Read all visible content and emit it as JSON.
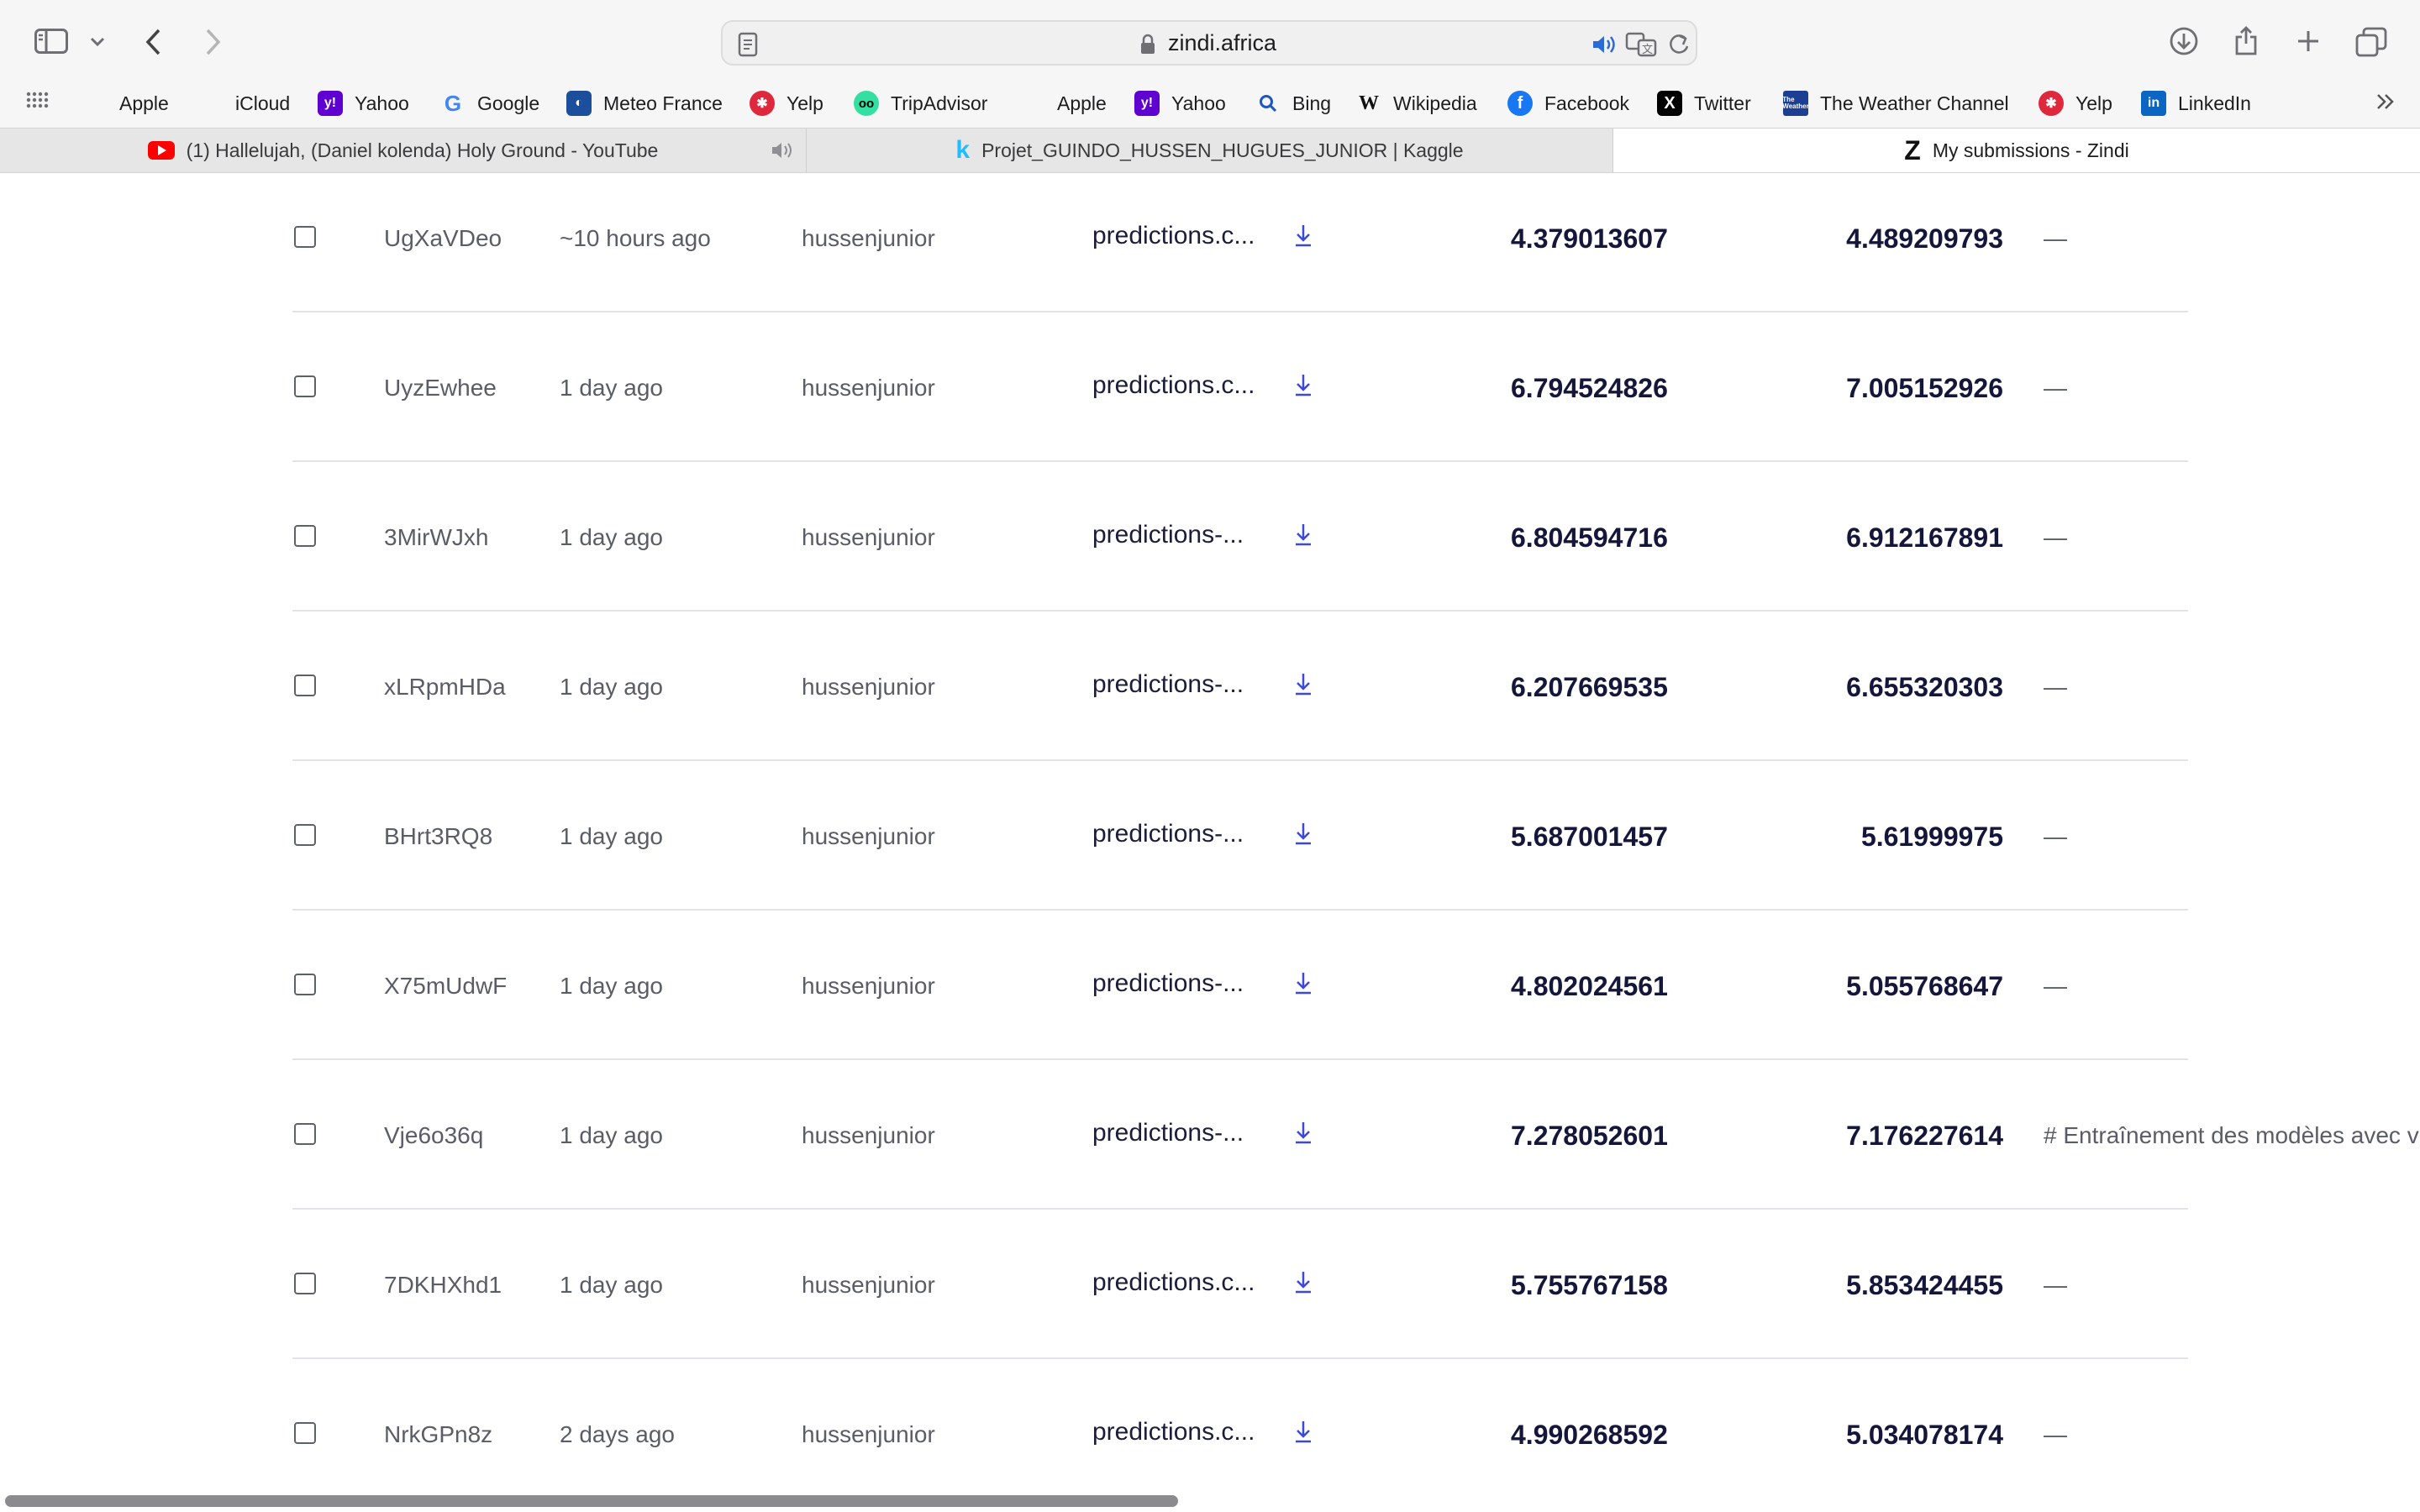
{
  "browser": {
    "url": "zindi.africa",
    "bookmarks": [
      {
        "label": "Apple",
        "icon": "apple-icon",
        "color": "#000000"
      },
      {
        "label": "iCloud",
        "icon": "apple-icon",
        "color": "#555555"
      },
      {
        "label": "Yahoo",
        "icon": "yahoo-icon",
        "color": "#5f01d1"
      },
      {
        "label": "Google",
        "icon": "google-icon",
        "color": "#4285f4"
      },
      {
        "label": "Meteo France",
        "icon": "meteo-france-icon",
        "color": "#1b4f9c"
      },
      {
        "label": "Yelp",
        "icon": "yelp-icon",
        "color": "#e0283d"
      },
      {
        "label": "TripAdvisor",
        "icon": "tripadvisor-icon",
        "color": "#34e0a1"
      },
      {
        "label": "Apple",
        "icon": "apple-icon",
        "color": "#000000"
      },
      {
        "label": "Yahoo",
        "icon": "yahoo-icon",
        "color": "#5f01d1"
      },
      {
        "label": "Bing",
        "icon": "search-icon",
        "color": "#1a56c4"
      },
      {
        "label": "Wikipedia",
        "icon": "wikipedia-icon",
        "color": "#111111"
      },
      {
        "label": "Facebook",
        "icon": "facebook-icon",
        "color": "#1877f2"
      },
      {
        "label": "Twitter",
        "icon": "x-icon",
        "color": "#000000"
      },
      {
        "label": "The Weather Channel",
        "icon": "weather-channel-icon",
        "color": "#1c3f94"
      },
      {
        "label": "Yelp",
        "icon": "yelp-icon",
        "color": "#e0283d"
      },
      {
        "label": "LinkedIn",
        "icon": "linkedin-icon",
        "color": "#0a66c2"
      }
    ],
    "tabs": [
      {
        "label": "(1) Hallelujah, (Daniel kolenda) Holy Ground - YouTube",
        "icon": "youtube-icon",
        "active": false
      },
      {
        "label": "Projet_GUINDO_HUSSEN_HUGUES_JUNIOR | Kaggle",
        "icon": "kaggle-icon",
        "active": false
      },
      {
        "label": "My submissions - Zindi",
        "icon": "zindi-icon",
        "active": true
      }
    ]
  },
  "submissions": [
    {
      "id": "UgXaVDeo",
      "date": "~10 hours ago",
      "user": "hussenjunior",
      "file": "predictions.c...",
      "public_score": "4.379013607",
      "private_score": "4.489209793",
      "comment": "—"
    },
    {
      "id": "UyzEwhee",
      "date": "1 day ago",
      "user": "hussenjunior",
      "file": "predictions.c...",
      "public_score": "6.794524826",
      "private_score": "7.005152926",
      "comment": "—"
    },
    {
      "id": "3MirWJxh",
      "date": "1 day ago",
      "user": "hussenjunior",
      "file": "predictions-...",
      "public_score": "6.804594716",
      "private_score": "6.912167891",
      "comment": "—"
    },
    {
      "id": "xLRpmHDa",
      "date": "1 day ago",
      "user": "hussenjunior",
      "file": "predictions-...",
      "public_score": "6.207669535",
      "private_score": "6.655320303",
      "comment": "—"
    },
    {
      "id": "BHrt3RQ8",
      "date": "1 day ago",
      "user": "hussenjunior",
      "file": "predictions-...",
      "public_score": "5.687001457",
      "private_score": "5.61999975",
      "comment": "—"
    },
    {
      "id": "X75mUdwF",
      "date": "1 day ago",
      "user": "hussenjunior",
      "file": "predictions-...",
      "public_score": "4.802024561",
      "private_score": "5.055768647",
      "comment": "—"
    },
    {
      "id": "Vje6o36q",
      "date": "1 day ago",
      "user": "hussenjunior",
      "file": "predictions-...",
      "public_score": "7.278052601",
      "private_score": "7.176227614",
      "comment": "# Entraînement des modèles avec v"
    },
    {
      "id": "7DKHXhd1",
      "date": "1 day ago",
      "user": "hussenjunior",
      "file": "predictions.c...",
      "public_score": "5.755767158",
      "private_score": "5.853424455",
      "comment": "—"
    },
    {
      "id": "NrkGPn8z",
      "date": "2 days ago",
      "user": "hussenjunior",
      "file": "predictions.c...",
      "public_score": "4.990268592",
      "private_score": "5.034078174",
      "comment": "—"
    }
  ]
}
